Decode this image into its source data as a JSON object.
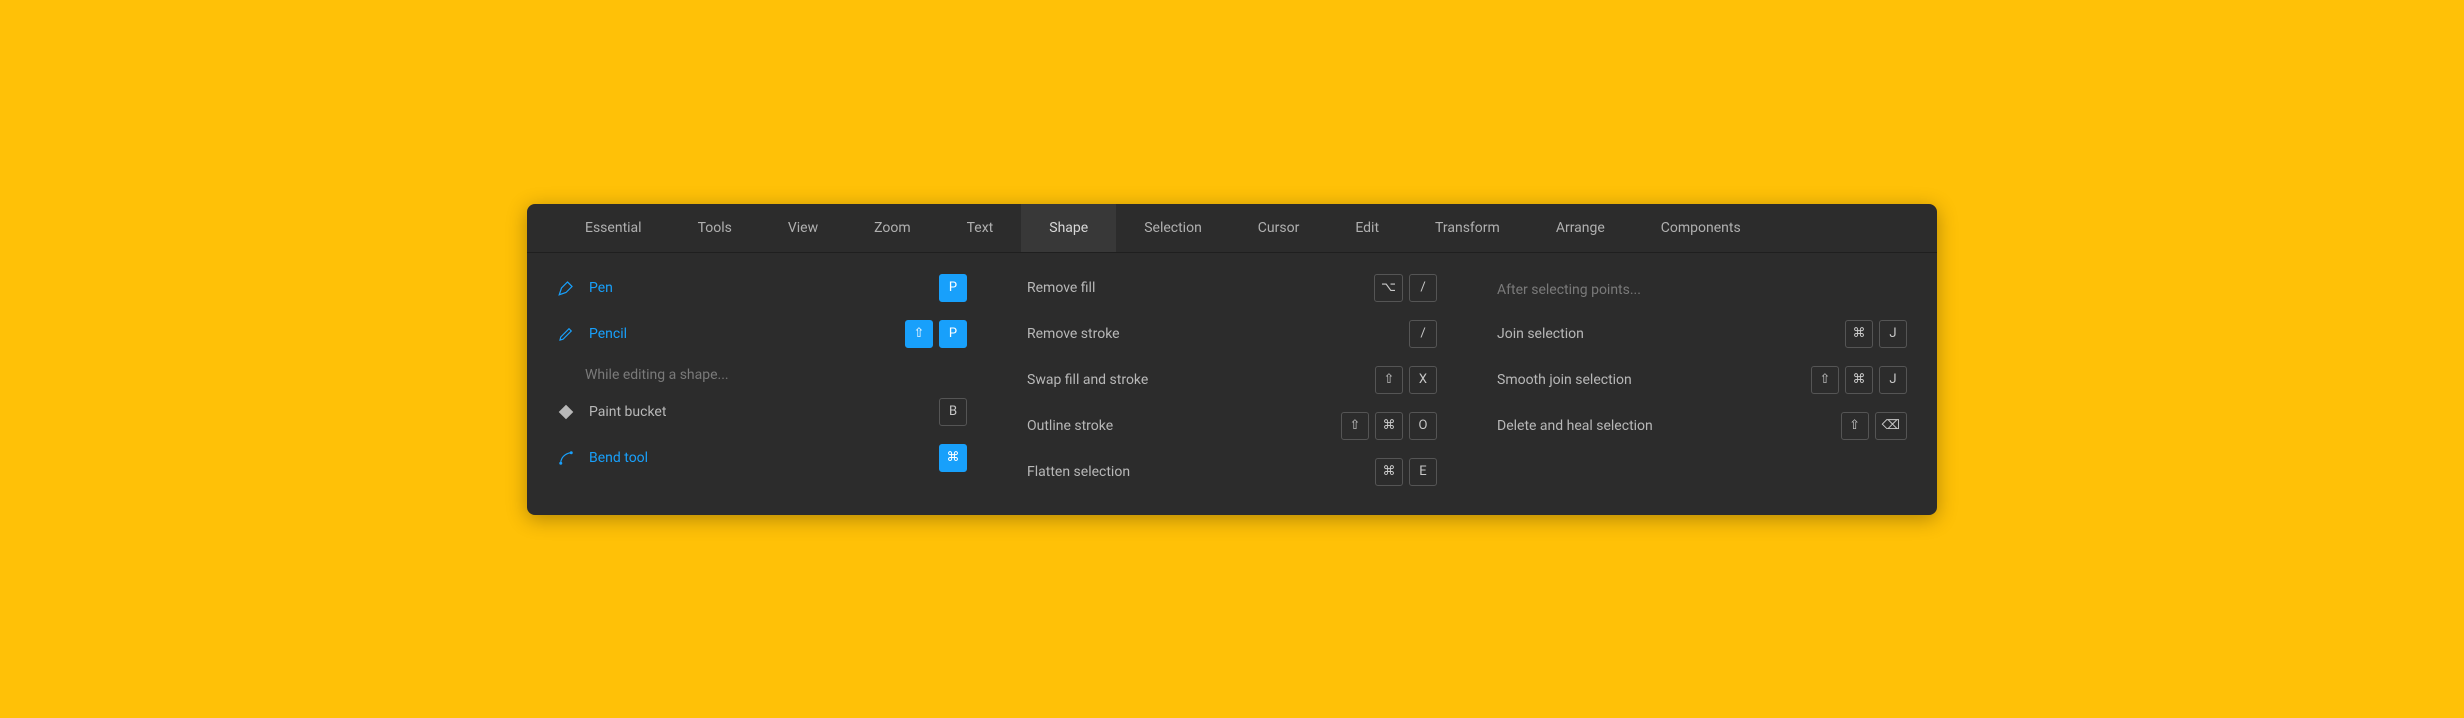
{
  "tabs": [
    {
      "label": "Essential",
      "active": false
    },
    {
      "label": "Tools",
      "active": false
    },
    {
      "label": "View",
      "active": false
    },
    {
      "label": "Zoom",
      "active": false
    },
    {
      "label": "Text",
      "active": false
    },
    {
      "label": "Shape",
      "active": true
    },
    {
      "label": "Selection",
      "active": false
    },
    {
      "label": "Cursor",
      "active": false
    },
    {
      "label": "Edit",
      "active": false
    },
    {
      "label": "Transform",
      "active": false
    },
    {
      "label": "Arrange",
      "active": false
    },
    {
      "label": "Components",
      "active": false
    }
  ],
  "col1": {
    "pen": {
      "label": "Pen",
      "key": "P"
    },
    "pencil": {
      "label": "Pencil",
      "keys": [
        "⇧",
        "P"
      ]
    },
    "hint": "While editing a shape...",
    "paintBucket": {
      "label": "Paint bucket",
      "key": "B"
    },
    "bend": {
      "label": "Bend tool",
      "key": "⌘"
    }
  },
  "col2": {
    "removeFill": {
      "label": "Remove fill",
      "keys": [
        "⌥",
        "/"
      ]
    },
    "removeStroke": {
      "label": "Remove stroke",
      "keys": [
        "/"
      ]
    },
    "swap": {
      "label": "Swap fill and stroke",
      "keys": [
        "⇧",
        "X"
      ]
    },
    "outline": {
      "label": "Outline stroke",
      "keys": [
        "⇧",
        "⌘",
        "O"
      ]
    },
    "flatten": {
      "label": "Flatten selection",
      "keys": [
        "⌘",
        "E"
      ]
    }
  },
  "col3": {
    "hint": "After selecting points...",
    "join": {
      "label": "Join selection",
      "keys": [
        "⌘",
        "J"
      ]
    },
    "smooth": {
      "label": "Smooth join selection",
      "keys": [
        "⇧",
        "⌘",
        "J"
      ]
    },
    "deleteHeal": {
      "label": "Delete and heal selection",
      "keys": [
        "⇧",
        "⌫"
      ]
    }
  }
}
